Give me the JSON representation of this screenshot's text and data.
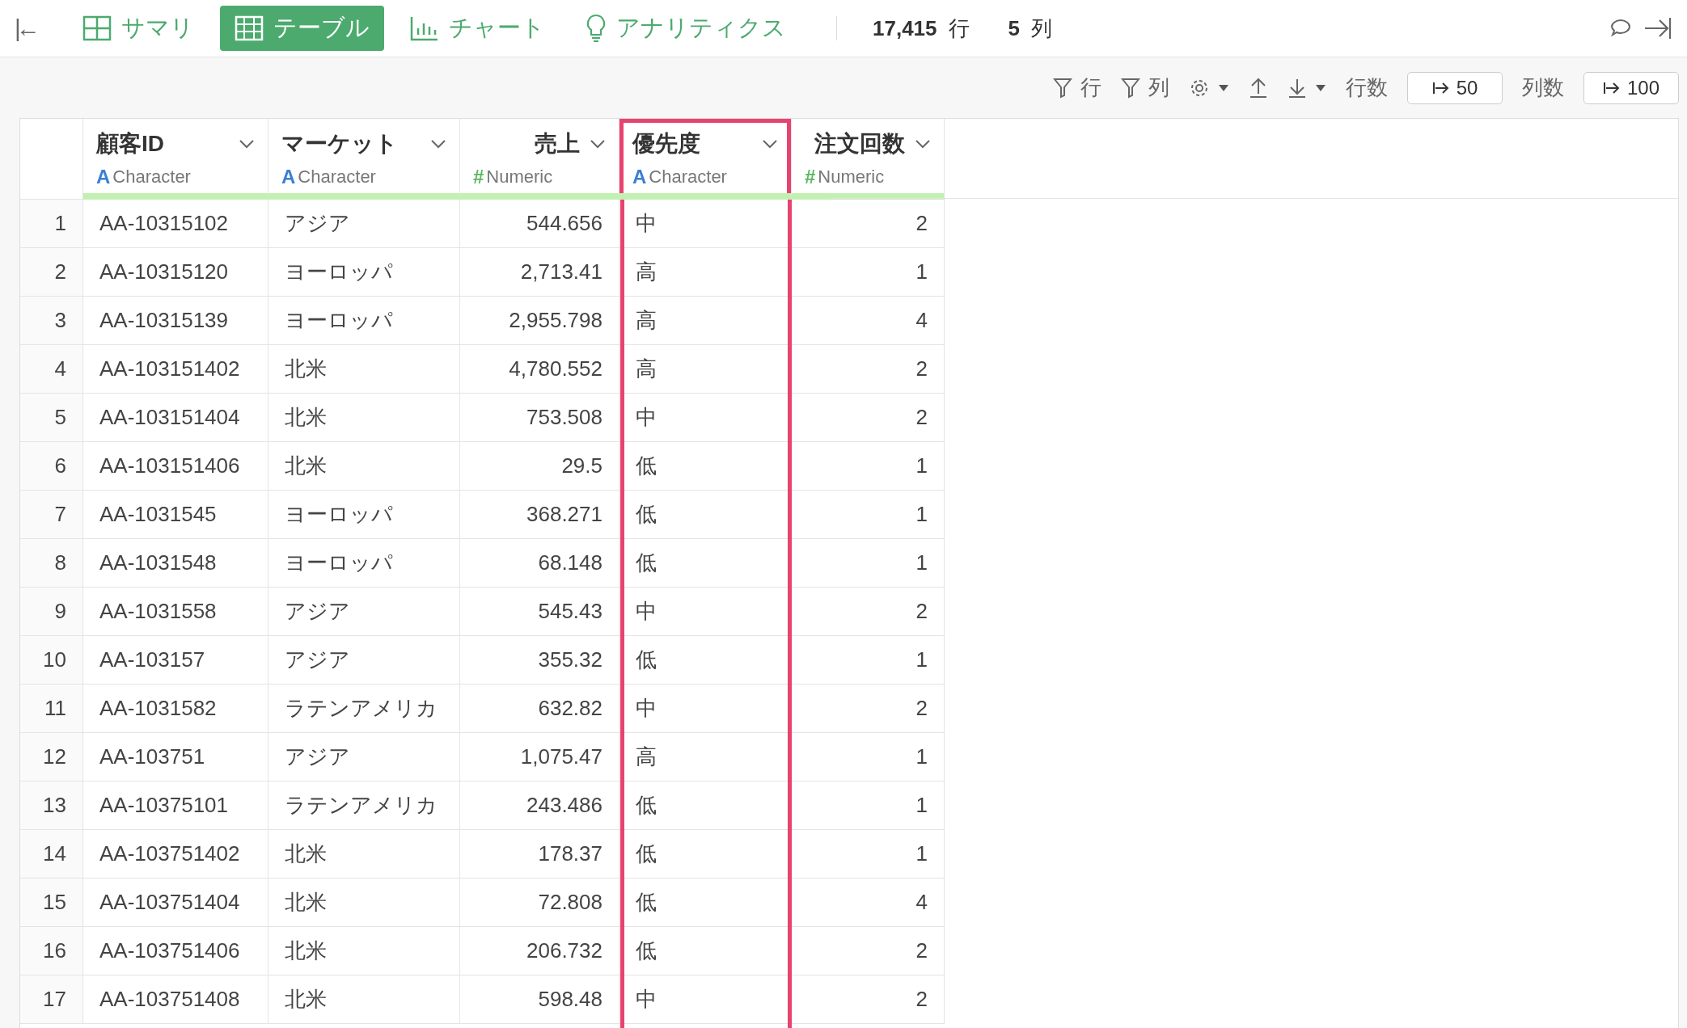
{
  "nav": {
    "back": "|←",
    "tabs": [
      {
        "label": "サマリ",
        "selected": false
      },
      {
        "label": "テーブル",
        "selected": true
      },
      {
        "label": "チャート",
        "selected": false
      },
      {
        "label": "アナリティクス",
        "selected": false
      }
    ],
    "row_count": "17,415",
    "row_unit": "行",
    "col_count": "5",
    "col_unit": "列"
  },
  "toolbar": {
    "row_filter": "行",
    "col_filter": "列",
    "rows_label": "行数",
    "rows_value": "50",
    "cols_label": "列数",
    "cols_value": "100"
  },
  "table": {
    "columns": [
      {
        "name": "顧客ID",
        "kind": "character",
        "type_mark": "A",
        "type": "Character",
        "highlighted": false
      },
      {
        "name": "マーケット",
        "kind": "character",
        "type_mark": "A",
        "type": "Character",
        "highlighted": false
      },
      {
        "name": "売上",
        "kind": "numeric",
        "type_mark": "#",
        "type": "Numeric",
        "highlighted": false
      },
      {
        "name": "優先度",
        "kind": "character",
        "type_mark": "A",
        "type": "Character",
        "highlighted": true
      },
      {
        "name": "注文回数",
        "kind": "numeric",
        "type_mark": "#",
        "type": "Numeric",
        "highlighted": false
      }
    ],
    "rows": [
      {
        "row_number": "1",
        "cells": [
          "AA-10315102",
          "アジア",
          "544.656",
          "中",
          "2"
        ]
      },
      {
        "row_number": "2",
        "cells": [
          "AA-10315120",
          "ヨーロッパ",
          "2,713.41",
          "高",
          "1"
        ]
      },
      {
        "row_number": "3",
        "cells": [
          "AA-10315139",
          "ヨーロッパ",
          "2,955.798",
          "高",
          "4"
        ]
      },
      {
        "row_number": "4",
        "cells": [
          "AA-103151402",
          "北米",
          "4,780.552",
          "高",
          "2"
        ]
      },
      {
        "row_number": "5",
        "cells": [
          "AA-103151404",
          "北米",
          "753.508",
          "中",
          "2"
        ]
      },
      {
        "row_number": "6",
        "cells": [
          "AA-103151406",
          "北米",
          "29.5",
          "低",
          "1"
        ]
      },
      {
        "row_number": "7",
        "cells": [
          "AA-1031545",
          "ヨーロッパ",
          "368.271",
          "低",
          "1"
        ]
      },
      {
        "row_number": "8",
        "cells": [
          "AA-1031548",
          "ヨーロッパ",
          "68.148",
          "低",
          "1"
        ]
      },
      {
        "row_number": "9",
        "cells": [
          "AA-1031558",
          "アジア",
          "545.43",
          "中",
          "2"
        ]
      },
      {
        "row_number": "10",
        "cells": [
          "AA-103157",
          "アジア",
          "355.32",
          "低",
          "1"
        ]
      },
      {
        "row_number": "11",
        "cells": [
          "AA-1031582",
          "ラテンアメリカ",
          "632.82",
          "中",
          "2"
        ]
      },
      {
        "row_number": "12",
        "cells": [
          "AA-103751",
          "アジア",
          "1,075.47",
          "高",
          "1"
        ]
      },
      {
        "row_number": "13",
        "cells": [
          "AA-10375101",
          "ラテンアメリカ",
          "243.486",
          "低",
          "1"
        ]
      },
      {
        "row_number": "14",
        "cells": [
          "AA-103751402",
          "北米",
          "178.37",
          "低",
          "1"
        ]
      },
      {
        "row_number": "15",
        "cells": [
          "AA-103751404",
          "北米",
          "72.808",
          "低",
          "4"
        ]
      },
      {
        "row_number": "16",
        "cells": [
          "AA-103751406",
          "北米",
          "206.732",
          "低",
          "2"
        ]
      },
      {
        "row_number": "17",
        "cells": [
          "AA-103751408",
          "北米",
          "598.48",
          "中",
          "2"
        ]
      }
    ]
  }
}
